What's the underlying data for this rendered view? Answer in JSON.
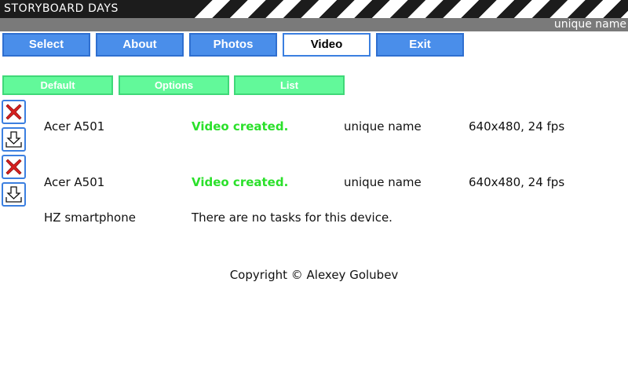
{
  "header": {
    "title": "STORYBOARD DAYS",
    "user": "unique name"
  },
  "nav": {
    "select": "Select",
    "about": "About",
    "photos": "Photos",
    "video": "Video",
    "exit": "Exit"
  },
  "subnav": {
    "default": "Default",
    "options": "Options",
    "list": "List"
  },
  "tasks": [
    {
      "device": "Acer A501",
      "status": "Video created.",
      "name": "unique name",
      "format": "640x480, 24 fps"
    },
    {
      "device": "Acer A501",
      "status": "Video created.",
      "name": "unique name",
      "format": "640x480, 24 fps"
    }
  ],
  "empty_device": {
    "device": "HZ smartphone",
    "message": "There are no tasks for this device."
  },
  "footer": {
    "copyright": "Copyright © Alexey Golubev"
  },
  "colors": {
    "nav_blue": "#4a8eea",
    "sub_green": "#62f99a",
    "status_green": "#2be02b",
    "delete_red": "#d62020"
  }
}
